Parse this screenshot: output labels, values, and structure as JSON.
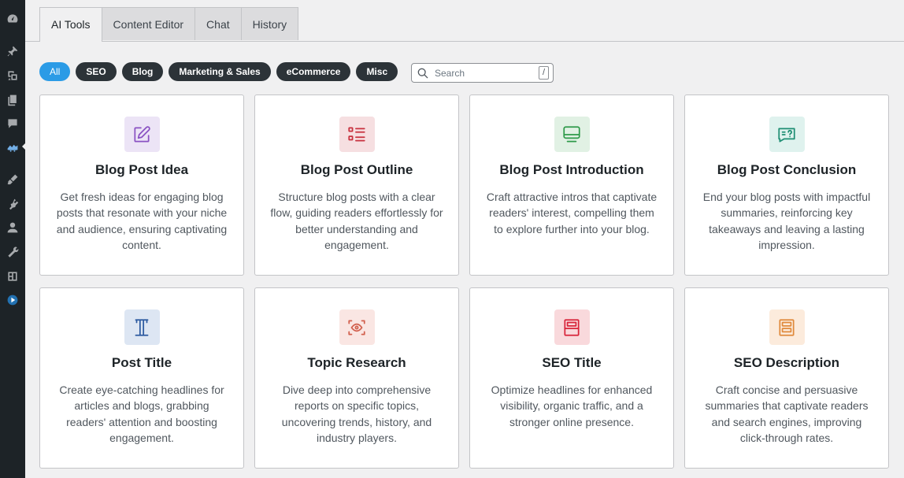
{
  "sidebar": {
    "icons": [
      "dashboard-icon",
      "pin-icon",
      "media-icon",
      "pages-icon",
      "comments-icon",
      "ai-plugin-icon",
      "appearance-icon",
      "plugins-icon",
      "users-icon",
      "tools-icon",
      "blocks-icon",
      "video-icon"
    ]
  },
  "tabs": [
    {
      "label": "AI Tools",
      "active": true
    },
    {
      "label": "Content Editor",
      "active": false
    },
    {
      "label": "Chat",
      "active": false
    },
    {
      "label": "History",
      "active": false
    }
  ],
  "filters": [
    {
      "label": "All",
      "active": true
    },
    {
      "label": "SEO",
      "active": false
    },
    {
      "label": "Blog",
      "active": false
    },
    {
      "label": "Marketing & Sales",
      "active": false
    },
    {
      "label": "eCommerce",
      "active": false
    },
    {
      "label": "Misc",
      "active": false
    }
  ],
  "search": {
    "placeholder": "Search",
    "shortcut": "/"
  },
  "cards": [
    {
      "title": "Blog Post Idea",
      "description": "Get fresh ideas for engaging blog posts that resonate with your niche and audience, ensuring captivating content.",
      "icon": "edit-icon",
      "icon_bg": "#ece4f6",
      "icon_color": "#8a52c3"
    },
    {
      "title": "Blog Post Outline",
      "description": "Structure blog posts with a clear flow, guiding readers effortlessly for better understanding and engagement.",
      "icon": "list-icon",
      "icon_bg": "#f6dfe1",
      "icon_color": "#c8323f"
    },
    {
      "title": "Blog Post Introduction",
      "description": "Craft attractive intros that captivate readers' interest, compelling them to explore further into your blog.",
      "icon": "monitor-icon",
      "icon_bg": "#e1f1e4",
      "icon_color": "#2f9a4a"
    },
    {
      "title": "Blog Post Conclusion",
      "description": "End your blog posts with impactful summaries, reinforcing key takeaways and leaving a lasting impression.",
      "icon": "message-question-icon",
      "icon_bg": "#dff2ee",
      "icon_color": "#1f8f74"
    },
    {
      "title": "Post Title",
      "description": "Create eye-catching headlines for articles and blogs, grabbing readers' attention and boosting engagement.",
      "icon": "title-icon",
      "icon_bg": "#dde6f3",
      "icon_color": "#2c5aa0"
    },
    {
      "title": "Topic Research",
      "description": "Dive deep into comprehensive reports on specific topics, uncovering trends, history, and industry players.",
      "icon": "scan-eye-icon",
      "icon_bg": "#fae6e3",
      "icon_color": "#d2604e"
    },
    {
      "title": "SEO Title",
      "description": "Optimize headlines for enhanced visibility, organic traffic, and a stronger online presence.",
      "icon": "layout-title-icon",
      "icon_bg": "#f9d9dc",
      "icon_color": "#d8243a"
    },
    {
      "title": "SEO Description",
      "description": "Craft concise and persuasive summaries that captivate readers and search engines, improving click-through rates.",
      "icon": "layout-description-icon",
      "icon_bg": "#fcebdc",
      "icon_color": "#e08a3c"
    }
  ]
}
